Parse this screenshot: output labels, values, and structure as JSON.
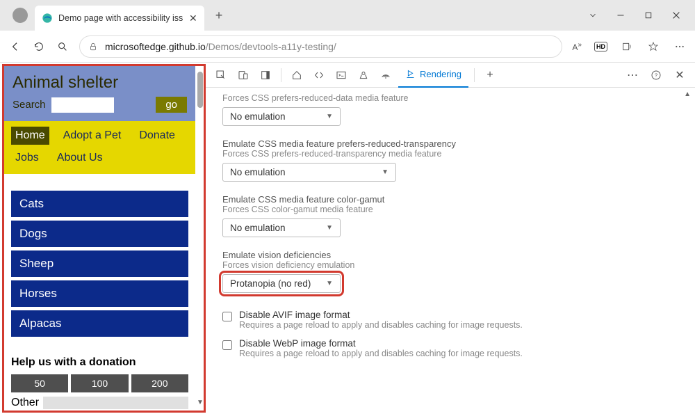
{
  "browser": {
    "tab_title": "Demo page with accessibility issu",
    "url_host": "microsoftedge.github.io",
    "url_path": "/Demos/devtools-a11y-testing/",
    "hd_badge": "HD"
  },
  "page": {
    "title": "Animal shelter",
    "search_label": "Search",
    "go": "go",
    "nav": [
      "Home",
      "Adopt a Pet",
      "Donate",
      "Jobs",
      "About Us"
    ],
    "categories": [
      "Cats",
      "Dogs",
      "Sheep",
      "Horses",
      "Alpacas"
    ],
    "donate_heading": "Help us with a donation",
    "donate_amounts": [
      "50",
      "100",
      "200"
    ],
    "other_label": "Other"
  },
  "devtools": {
    "rendering_tab": "Rendering",
    "sections": {
      "reduced_data_sub": "Forces CSS prefers-reduced-data media feature",
      "reduced_data_value": "No emulation",
      "transparency_title": "Emulate CSS media feature prefers-reduced-transparency",
      "transparency_sub": "Forces CSS prefers-reduced-transparency media feature",
      "transparency_value": "No emulation",
      "gamut_title": "Emulate CSS media feature color-gamut",
      "gamut_sub": "Forces CSS color-gamut media feature",
      "gamut_value": "No emulation",
      "vision_title": "Emulate vision deficiencies",
      "vision_sub": "Forces vision deficiency emulation",
      "vision_value": "Protanopia (no red)",
      "avif_title": "Disable AVIF image format",
      "avif_sub": "Requires a page reload to apply and disables caching for image requests.",
      "webp_title": "Disable WebP image format",
      "webp_sub": "Requires a page reload to apply and disables caching for image requests."
    }
  }
}
